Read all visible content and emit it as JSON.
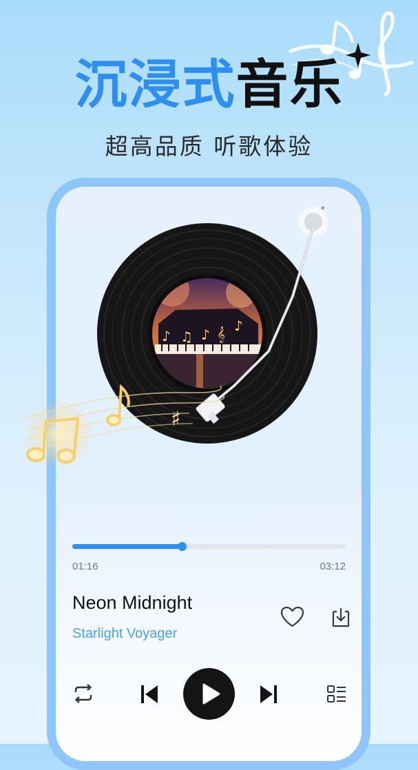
{
  "headline": {
    "part_blue": "沉浸式",
    "part_black": "音乐"
  },
  "subtitle": "超高品质 听歌体验",
  "player": {
    "progress": 0.4,
    "elapsed": "01:16",
    "duration": "03:12",
    "song_title": "Neon Midnight",
    "artist": "Starlight Voyager"
  },
  "icons": {
    "favorite": "heart-icon",
    "download": "download-icon",
    "repeat": "repeat-icon",
    "previous": "previous-icon",
    "play": "play-icon",
    "next": "next-icon",
    "playlist": "playlist-icon"
  },
  "colors": {
    "accent": "#2e8ff0",
    "frame": "#8ec6fa",
    "artist": "#4d9fe8"
  }
}
